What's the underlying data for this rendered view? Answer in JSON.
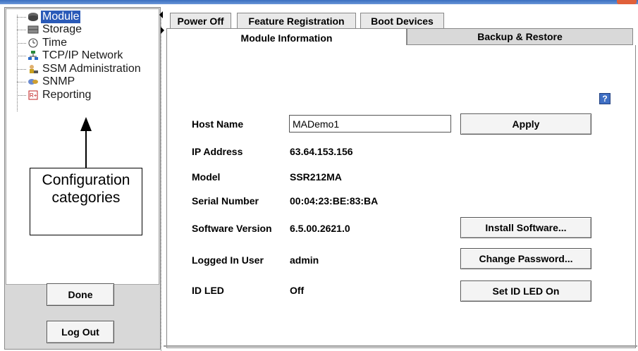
{
  "tree": {
    "items": [
      {
        "label": "Module",
        "icon": "module-icon",
        "selected": true
      },
      {
        "label": "Storage",
        "icon": "storage-icon"
      },
      {
        "label": "Time",
        "icon": "clock-icon"
      },
      {
        "label": "TCP/IP Network",
        "icon": "network-icon"
      },
      {
        "label": "SSM Administration",
        "icon": "admin-icon"
      },
      {
        "label": "SNMP",
        "icon": "snmp-icon"
      },
      {
        "label": "Reporting",
        "icon": "reporting-icon"
      }
    ]
  },
  "annotation": {
    "line1": "Configuration",
    "line2": "categories"
  },
  "left_buttons": {
    "done": "Done",
    "logout": "Log Out"
  },
  "tabs": {
    "row1": [
      "Power Off",
      "Feature Registration",
      "Boot Devices"
    ],
    "row2": [
      "Module Information",
      "Backup & Restore"
    ],
    "active": "Module Information"
  },
  "help": "?",
  "form": {
    "host_name_label": "Host Name",
    "host_name_value": "MADemo1",
    "apply_label": "Apply",
    "ip_label": "IP Address",
    "ip_value": "63.64.153.156",
    "model_label": "Model",
    "model_value": "SSR212MA",
    "serial_label": "Serial Number",
    "serial_value": "00:04:23:BE:83:BA",
    "software_label": "Software Version",
    "software_value": "6.5.00.2621.0",
    "install_label": "Install Software...",
    "user_label": "Logged In User",
    "user_value": "admin",
    "password_label": "Change Password...",
    "led_label": "ID LED",
    "led_value": "Off",
    "led_button_label": "Set ID LED On"
  },
  "colors": {
    "selection": "#2a5ab8",
    "help_icon": "#3f6fc4",
    "title_bar": "#3a6fc0"
  }
}
